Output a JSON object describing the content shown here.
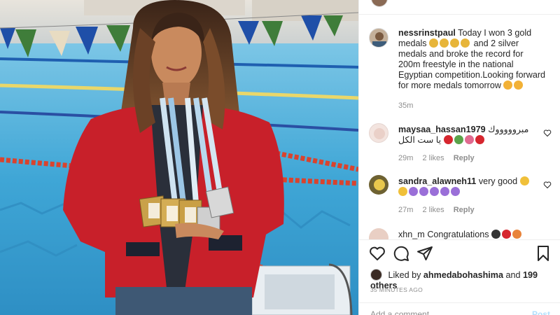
{
  "post": {
    "caption_user": "nessrinstpaul",
    "caption_text_1": "Today I won 3 gold medals",
    "caption_text_2": "and 2 silver medals and broke the record for 200m freestyle in the national Egyptian competition.Looking forward for more medals tomorrow",
    "caption_time": "35m"
  },
  "comments": [
    {
      "user": "maysaa_hassan1979",
      "text": "مبروووووك يا ست الكل",
      "time": "29m",
      "likes": "2 likes",
      "reply": "Reply"
    },
    {
      "user": "sandra_alawneh11",
      "text": "very good",
      "time": "27m",
      "likes": "2 likes",
      "reply": "Reply"
    },
    {
      "user": "xhn_m",
      "text": "Congratulations"
    }
  ],
  "actions": {
    "like_icon": "heart-icon",
    "comment_icon": "comment-icon",
    "share_icon": "share-icon",
    "save_icon": "bookmark-icon"
  },
  "likes": {
    "prefix": "Liked by",
    "user": "ahmedabohashima",
    "and": "and",
    "others": "199 others"
  },
  "timestamp": "35 MINUTES AGO",
  "add_comment": {
    "placeholder": "Add a comment...",
    "post_label": "Post"
  },
  "colors": {
    "accent": "#0095f6",
    "muted": "#8e8e8e",
    "text": "#262626",
    "jacket": "#c8202a",
    "pool": "#4fb0dc"
  }
}
